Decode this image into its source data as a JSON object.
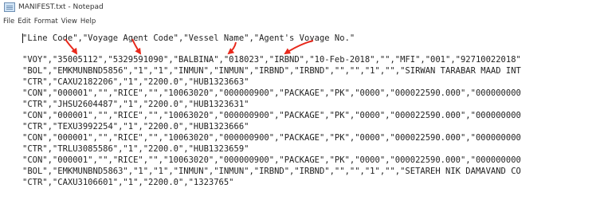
{
  "window": {
    "title": "MANIFEST.txt - Notepad"
  },
  "menu": [
    "File",
    "Edit",
    "Format",
    "View",
    "Help"
  ],
  "editor": {
    "lines": [
      "\"Line Code\",\"Voyage Agent Code\",\"Vessel Name\",\"Agent's Voyage No.\"",
      "",
      "\"VOY\",\"35005112\",\"5329591090\",\"BALBINA\",\"018023\",\"IRBND\",\"10-Feb-2018\",\"\",\"MFI\",\"001\",\"92710022018\"",
      "\"BOL\",\"EMKMUNBND5856\",\"1\",\"1\",\"INMUN\",\"INMUN\",\"IRBND\",\"IRBND\",\"\",\"\",\"1\",\"\",\"SIRWAN TARABAR MAAD INT",
      "\"CTR\",\"CAXU2182206\",\"1\",\"2200.0\",\"HUB1323663\"",
      "\"CON\",\"000001\",\"\",\"RICE\",\"\",\"10063020\",\"000000900\",\"PACKAGE\",\"PK\",\"0000\",\"000022590.000\",\"000000000",
      "\"CTR\",\"JHSU2604487\",\"1\",\"2200.0\",\"HUB1323631\"",
      "\"CON\",\"000001\",\"\",\"RICE\",\"\",\"10063020\",\"000000900\",\"PACKAGE\",\"PK\",\"0000\",\"000022590.000\",\"000000000",
      "\"CTR\",\"TEXU3992254\",\"1\",\"2200.0\",\"HUB1323666\"",
      "\"CON\",\"000001\",\"\",\"RICE\",\"\",\"10063020\",\"000000900\",\"PACKAGE\",\"PK\",\"0000\",\"000022590.000\",\"000000000",
      "\"CTR\",\"TRLU3085586\",\"1\",\"2200.0\",\"HUB1323659\"",
      "\"CON\",\"000001\",\"\",\"RICE\",\"\",\"10063020\",\"000000900\",\"PACKAGE\",\"PK\",\"0000\",\"000022590.000\",\"000000000",
      "\"BOL\",\"EMKMUNBND5863\",\"1\",\"1\",\"INMUN\",\"INMUN\",\"IRBND\",\"IRBND\",\"\",\"\",\"1\",\"\",\"SETAREH NIK DAMAVAND CO",
      "\"CTR\",\"CAXU3106601\",\"1\",\"2200.0\",\"1323765\""
    ]
  },
  "annotations": {
    "arrow_color": "#e8291c"
  }
}
